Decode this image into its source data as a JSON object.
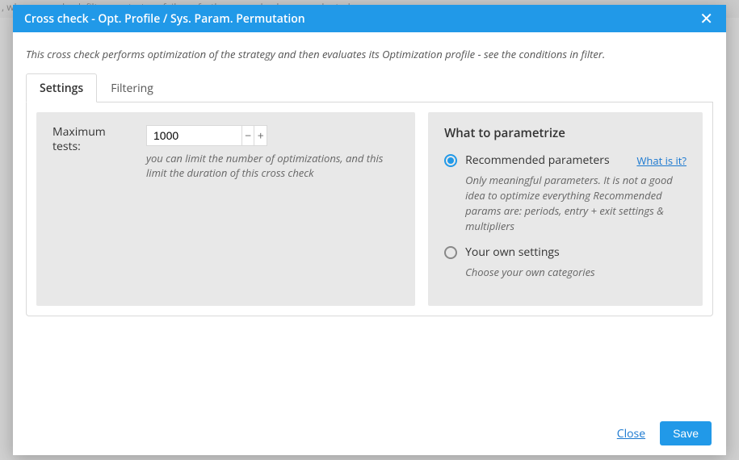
{
  "background_hint": ", when crosscheck filter on strategy fails no further crosschecks are evaluated.",
  "modal": {
    "title": "Cross check - Opt. Profile / Sys. Param. Permutation",
    "description": "This cross check performs optimization of the strategy and then evaluates its Optimization profile - see the conditions in filter.",
    "tabs": {
      "settings": "Settings",
      "filtering": "Filtering"
    },
    "left": {
      "max_tests_label": "Maximum tests:",
      "max_tests_value": "1000",
      "max_tests_help": "you can limit the number of optimizations, and this limit the duration of this cross check"
    },
    "right": {
      "heading": "What to parametrize",
      "opt_recommended": {
        "label": "Recommended parameters",
        "what_link": "What is it?",
        "help": "Only meaningful parameters. It is not a good idea to optimize everything\nRecommended params are: periods, entry + exit settings & multipliers"
      },
      "opt_own": {
        "label": "Your own settings",
        "help": "Choose your own categories"
      }
    },
    "footer": {
      "close": "Close",
      "save": "Save"
    }
  }
}
